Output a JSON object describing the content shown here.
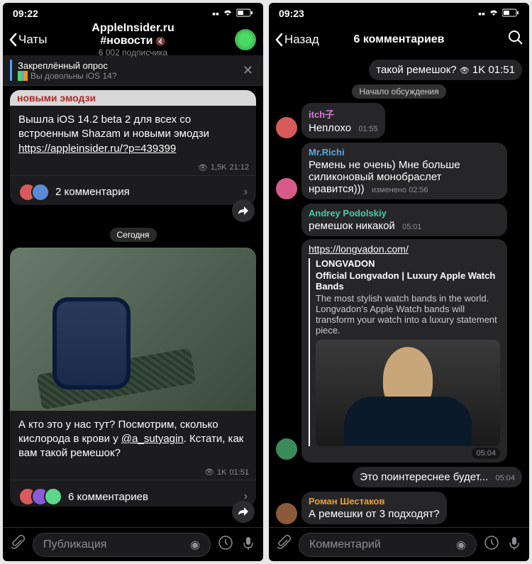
{
  "left": {
    "status": {
      "time": "09:22"
    },
    "nav": {
      "back": "Чаты",
      "title": "AppleInsider.ru #новости",
      "subtitle": "6 002 подписчика"
    },
    "pinned": {
      "title": "Закреплённый опрос",
      "subtitle": "Вы довольны iOS 14?"
    },
    "post1": {
      "top_cut": "новыми эмодзи",
      "body": "Вышла iOS 14.2 beta 2 для всех со встроенным Shazam и новыми эмодзи",
      "link": "https://appleinsider.ru/?p=439399",
      "views": "1,5K",
      "time": "21:12",
      "comments_label": "2 комментария"
    },
    "date_sep": "Сегодня",
    "post2": {
      "body": "А кто это у нас тут? Посмотрим, сколько кислорода в крови у",
      "mention": "@a_sutyagin",
      "body2": ". Кстати, как вам такой ремешок?",
      "views": "1K",
      "time": "01:51",
      "comments_label": "6 комментариев"
    },
    "input": {
      "placeholder": "Публикация"
    }
  },
  "right": {
    "status": {
      "time": "09:23"
    },
    "nav": {
      "back": "Назад",
      "title": "6 комментариев"
    },
    "top_reply": {
      "text": "такой ремешок?",
      "views": "1K",
      "time": "01:51"
    },
    "sys": "Начало обсуждения",
    "messages": [
      {
        "user": "itch子",
        "color": "c1",
        "text": "Неплохо",
        "time": "01:55"
      },
      {
        "user": "Mr.Richi",
        "color": "c2",
        "text": "Ремень не очень) Мне больше силиконовый монобраслет нравится)))",
        "edited": "изменено",
        "time": "02:56"
      },
      {
        "user": "Andrey Podolskiy",
        "color": "c3",
        "text": "ремешок никакой",
        "time": "05:01"
      }
    ],
    "link_msg": {
      "url": "https://longvadon.com/",
      "site": "LONGVADON",
      "title": "Official Longvadon | Luxury Apple Watch Bands",
      "desc": "The most stylish watch bands in the world. Longvadon's Apple Watch bands will transform your watch into a luxury statement piece.",
      "time": "05:04"
    },
    "out_msg": {
      "text": "Это поинтереснее будет...",
      "time": "05:04"
    },
    "last_msg": {
      "user": "Роман Шестаков",
      "color": "c4",
      "text": "А ремешки от 3 подходят?"
    },
    "input": {
      "placeholder": "Комментарий"
    }
  }
}
